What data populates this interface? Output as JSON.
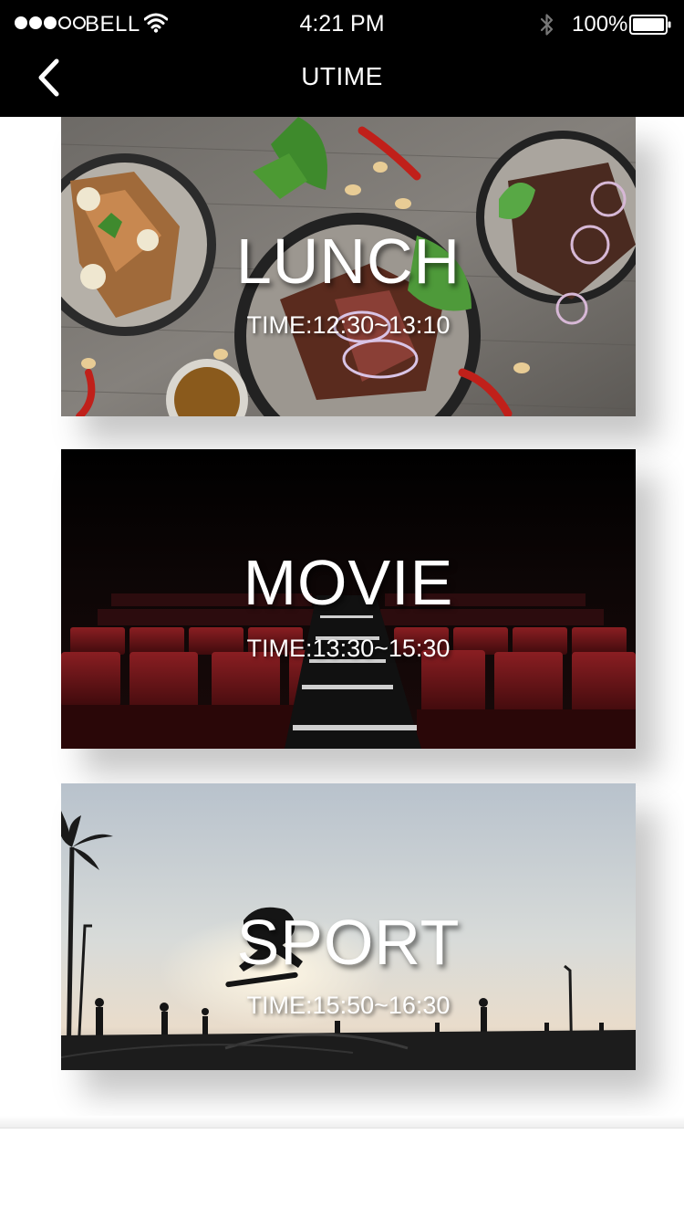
{
  "status_bar": {
    "carrier": "BELL",
    "time": "4:21 PM",
    "battery": "100%",
    "signal_bars_filled": 3,
    "signal_bars_total": 5,
    "icons": [
      "wifi-icon",
      "bluetooth-icon",
      "battery-icon"
    ]
  },
  "nav": {
    "title": "UTIME",
    "back_icon": "chevron-left-icon"
  },
  "cards": [
    {
      "id": "lunch",
      "title": "LUNCH",
      "time": "TIME:12:30~13:10",
      "image": "food-plates-photo"
    },
    {
      "id": "movie",
      "title": "MOVIE",
      "time": "TIME:13:30~15:30",
      "image": "cinema-seats-photo"
    },
    {
      "id": "sport",
      "title": "SPORT",
      "time": "TIME:15:50~16:30",
      "image": "skateboard-silhouette-photo"
    }
  ],
  "colors": {
    "bar_background": "#000000",
    "page_background": "#ffffff",
    "text_on_image": "#ffffff"
  }
}
